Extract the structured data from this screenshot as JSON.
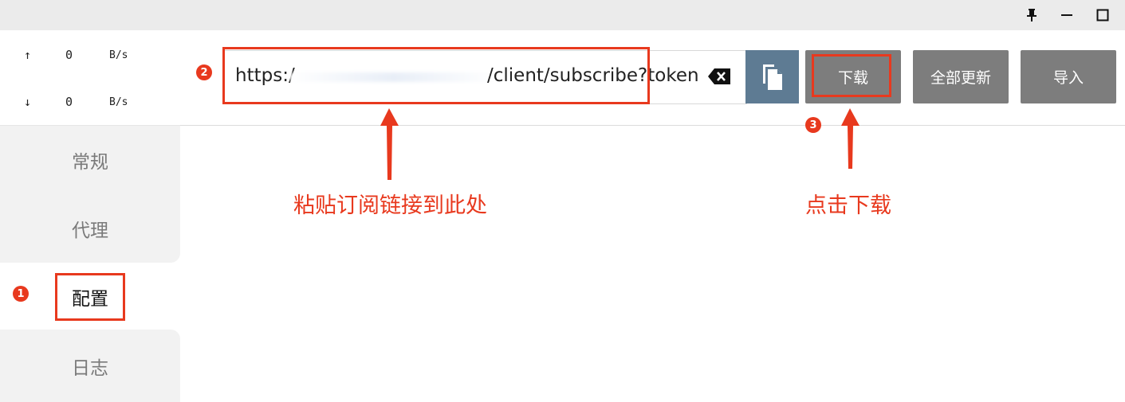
{
  "titlebar": {
    "buttons": [
      "pin-icon",
      "minimize-icon",
      "maximize-icon"
    ]
  },
  "traffic": {
    "up_arrow": "↑",
    "up_value": "0",
    "up_unit": "B/s",
    "down_arrow": "↓",
    "down_value": "0",
    "down_unit": "B/s"
  },
  "sidebar": {
    "items": [
      {
        "label": "常规"
      },
      {
        "label": "代理"
      },
      {
        "label": "配置"
      },
      {
        "label": "日志"
      }
    ],
    "active_index": 2
  },
  "subscription": {
    "url_prefix": "https:/",
    "url_suffix": "/client/subscribe?token"
  },
  "toolbar": {
    "download_label": "下载",
    "update_all_label": "全部更新",
    "import_label": "导入"
  },
  "annotations": {
    "badge_1": "1",
    "badge_2": "2",
    "badge_3": "3",
    "paste_hint": "粘贴订阅链接到此处",
    "download_hint": "点击下载"
  },
  "colors": {
    "accent_red": "#e8391e",
    "paste_button": "#5e7b93",
    "action_button": "#7d7d7d"
  }
}
